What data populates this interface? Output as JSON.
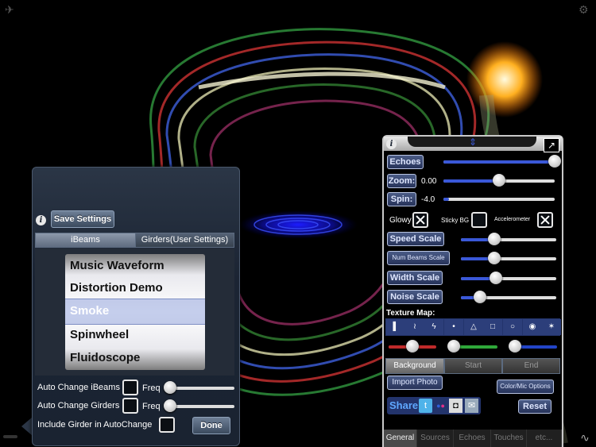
{
  "left_panel": {
    "save_settings": "Save Settings",
    "tabs": [
      "iBeams",
      "Girders(User Settings)"
    ],
    "picker_items": [
      "Music Waveform",
      "Distortion Demo",
      "Smoke",
      "Spinwheel",
      "Fluidoscope"
    ],
    "selected_item": "Smoke",
    "auto_change_ibeams": "Auto Change iBeams",
    "auto_change_girders": "Auto Change Girders",
    "freq": "Freq",
    "include_girder": "Include Girder in AutoChange",
    "done": "Done",
    "ibeams_freq": 0.08,
    "girders_freq": 0.08
  },
  "right_panel": {
    "echoes": "Echoes",
    "zoom": "Zoom:",
    "zoom_value": "0.00",
    "spin": "Spin:",
    "spin_value": "-4.0",
    "glowy": "Glowy",
    "sticky_bg": "Sticky BG",
    "accelerometer": "Accelerometer",
    "speed_scale": "Speed Scale",
    "num_beams_scale": "Num Beams Scale",
    "width_scale": "Width Scale",
    "noise_scale": "Noise Scale",
    "texture_map": "Texture Map:",
    "background": "Background",
    "start": "Start",
    "end": "End",
    "import_photo": "Import Photo",
    "color_mic_options": "Color/Mic Options",
    "share": "Share",
    "reset": "Reset",
    "tabs": [
      "General",
      "Sources",
      "Echoes",
      "Touches",
      "etc..."
    ],
    "active_tab": "General",
    "slider_values": {
      "echoes": 1.0,
      "zoom": 0.5,
      "spin": 0.05,
      "speed_scale": 0.35,
      "num_beams_scale": 0.35,
      "width_scale": 0.37,
      "noise_scale": 0.2,
      "color_red": 0.5,
      "color_green": 0.05,
      "color_blue": 0.05
    }
  },
  "colors": {
    "accent_blue": "#3a58d8",
    "panel_dark": "#1a2331",
    "button_blue": "#2c3a66"
  }
}
